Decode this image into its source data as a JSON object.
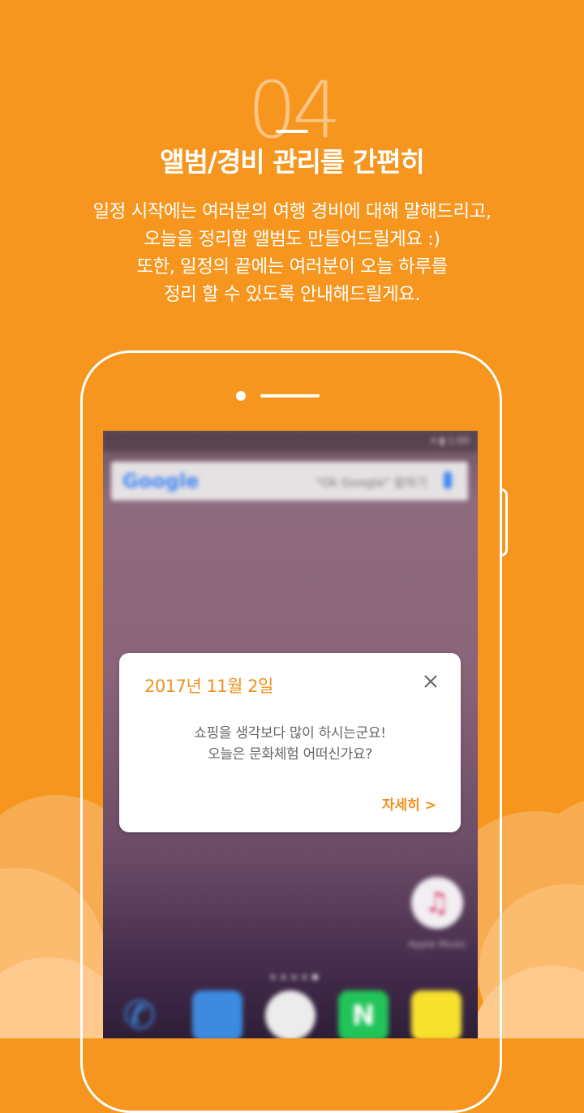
{
  "step_number": "04",
  "title": "앨범/경비 관리를 간편히",
  "description_lines": [
    "일정 시작에는 여러분의 여행 경비에 대해 말해드리고,",
    "오늘을 정리할 앨범도 만들어드릴게요 :)",
    "또한, 일정의 끝에는 여러분이 오늘 하루를",
    "정리 할 수 있도록 안내해드릴게요."
  ],
  "screen": {
    "search": {
      "logo": "Google",
      "hint": "\"Ok Google\" 말하기"
    },
    "music_app_label": "Apple Music",
    "dock_naver": "N",
    "icons": [
      "phone-icon",
      "message-icon",
      "apps-icon",
      "naver-icon",
      "kakaotalk-icon",
      "music-icon"
    ]
  },
  "card": {
    "date": "2017년 11월 2일",
    "message_lines": [
      "쇼핑을 생각보다 많이 하시는군요!",
      "오늘은 문화체험 어떠신가요?"
    ],
    "more_label": "자세히 >",
    "close_icon": "close-icon"
  },
  "colors": {
    "background": "#F6961E",
    "accent": "#F0901E",
    "cloud_light": "#FDC487",
    "cloud_mid": "#F9B25E"
  }
}
